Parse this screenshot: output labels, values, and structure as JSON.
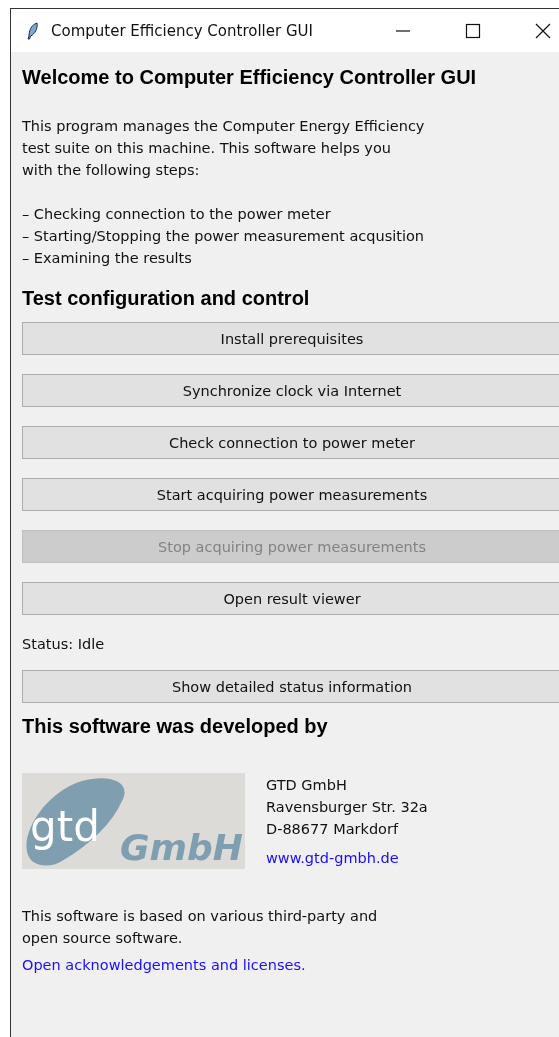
{
  "window": {
    "title": "Computer Efficiency Controller GUI"
  },
  "heading": "Welcome to Computer Efficiency Controller GUI",
  "intro": [
    "This program manages the Computer Energy Efficiency",
    "test suite on this machine. This software helps you",
    "with the following steps:"
  ],
  "steps": [
    "– Checking connection to the power meter",
    "– Starting/Stopping the power measurement acqusition",
    "– Examining the results"
  ],
  "section_title": "Test configuration and control",
  "buttons": [
    {
      "label": "Install prerequisites",
      "disabled": false
    },
    {
      "label": "Synchronize clock via Internet",
      "disabled": false
    },
    {
      "label": "Check connection to power meter",
      "disabled": false
    },
    {
      "label": "Start acquiring power measurements",
      "disabled": false
    },
    {
      "label": "Stop acquiring power measurements",
      "disabled": true
    },
    {
      "label": "Open result viewer",
      "disabled": false
    }
  ],
  "status": "Status: Idle",
  "details_button": {
    "label": "Show detailed status information",
    "disabled": false
  },
  "developer_title": "This software was developed by",
  "logo": {
    "mark": "gtd",
    "word": "GmbH"
  },
  "address": [
    "GTD GmbH",
    "Ravensburger Str. 32a",
    "D-88677 Markdorf"
  ],
  "website": "www.gtd-gmbh.de",
  "notice": [
    "This software is based on various third-party and",
    "open source software."
  ],
  "licenses_link": "Open acknowledgements and licenses."
}
